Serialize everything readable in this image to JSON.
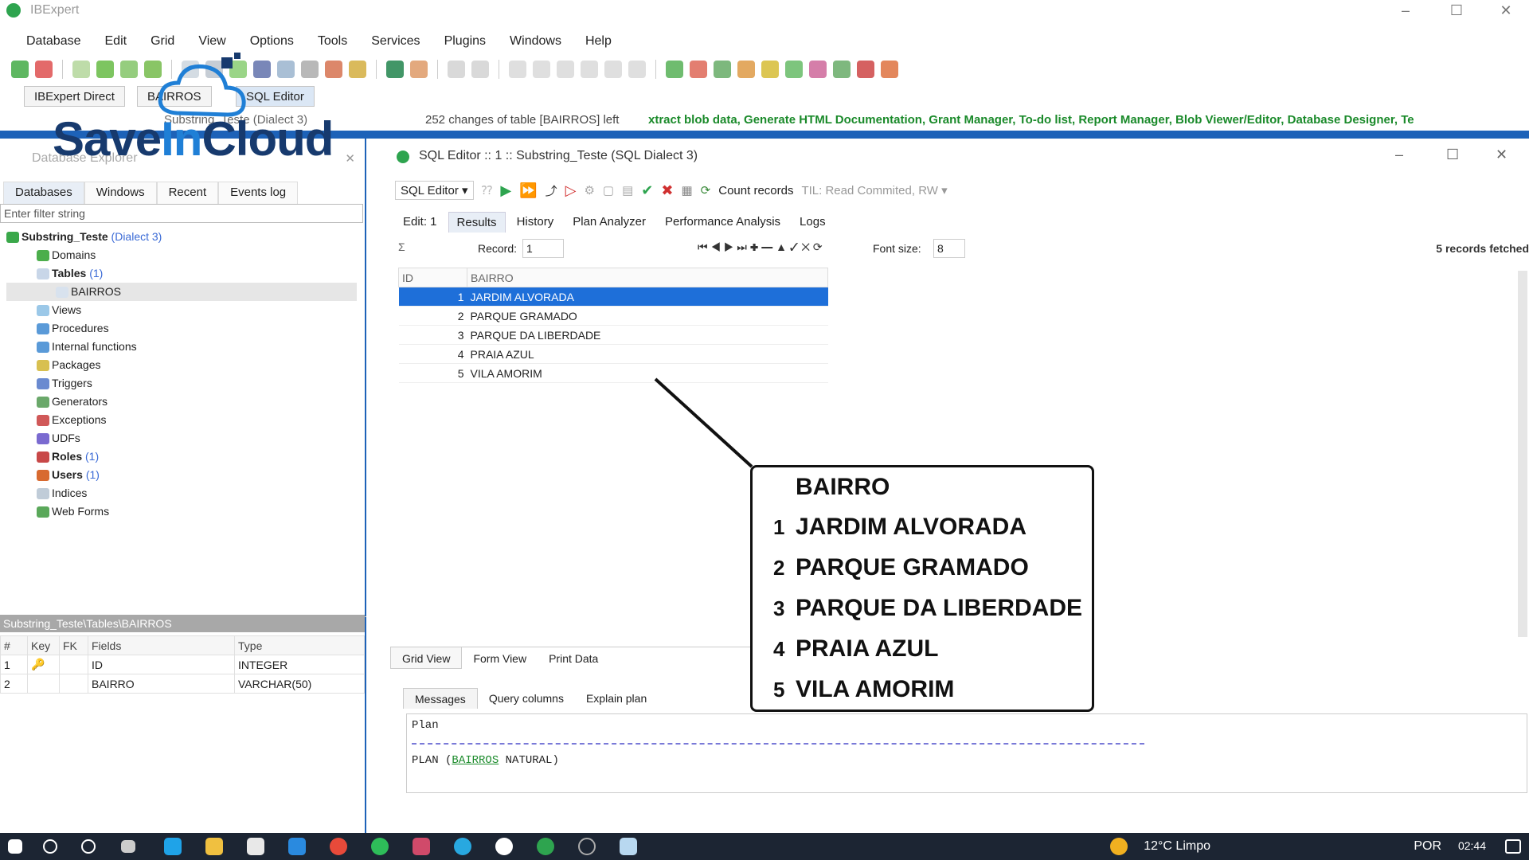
{
  "window": {
    "title": "IBExpert",
    "min": "–",
    "max": "☐",
    "close": "✕"
  },
  "menu": [
    "Database",
    "Edit",
    "Grid",
    "View",
    "Options",
    "Tools",
    "Services",
    "Plugins",
    "Windows",
    "Help"
  ],
  "tabs": {
    "direct": "IBExpert Direct",
    "bairros": "BAIRROS",
    "sql": "SQL Editor"
  },
  "status_strip": {
    "sub": "Substring_Teste (Dialect 3)",
    "changes": "252 changes of table [BAIRROS] left",
    "marquee": "xtract blob data, Generate HTML Documentation, Grant Manager, To-do list, Report Manager, Blob Viewer/Editor, Database Designer, Te"
  },
  "watermark": {
    "part1": "Save",
    "part2": "In",
    "part3": "Cloud"
  },
  "left": {
    "panel_title": "Database Explorer",
    "tabs": [
      "Databases",
      "Windows",
      "Recent",
      "Events log"
    ],
    "filter_placeholder": "Enter filter string",
    "tree": {
      "db": "Substring_Teste",
      "db_dialect": "(Dialect 3)",
      "domains": "Domains",
      "tables": "Tables",
      "tables_count": "(1)",
      "bairros": "BAIRROS",
      "views": "Views",
      "procedures": "Procedures",
      "internal_functions": "Internal functions",
      "packages": "Packages",
      "triggers": "Triggers",
      "generators": "Generators",
      "exceptions": "Exceptions",
      "udfs": "UDFs",
      "roles": "Roles",
      "roles_count": "(1)",
      "users": "Users",
      "users_count": "(1)",
      "indices": "Indices",
      "web_forms": "Web Forms"
    },
    "field_path": "Substring_Teste\\Tables\\BAIRROS",
    "field_headers": [
      "#",
      "Key",
      "FK",
      "Fields",
      "Type"
    ],
    "fields": [
      {
        "n": "1",
        "key": "🔑",
        "fk": "",
        "name": "ID",
        "type": "INTEGER"
      },
      {
        "n": "2",
        "key": "",
        "fk": "",
        "name": "BAIRRO",
        "type": "VARCHAR(50)"
      }
    ]
  },
  "sql": {
    "caption": "SQL Editor :: 1 :: Substring_Teste (SQL Dialect 3)",
    "editor_button": "SQL Editor ▾",
    "count_records": "Count records",
    "til": "TIL: Read Commited, RW ▾",
    "subtabs": [
      "Edit: 1",
      "Results",
      "History",
      "Plan Analyzer",
      "Performance Analysis",
      "Logs"
    ],
    "record_label": "Record:",
    "record_value": "1",
    "font_label": "Font size:",
    "font_value": "8",
    "fetched": "5 records fetched",
    "columns": [
      "ID",
      "BAIRRO"
    ],
    "rows": [
      {
        "id": "1",
        "bairro": "JARDIM ALVORADA"
      },
      {
        "id": "2",
        "bairro": "PARQUE GRAMADO"
      },
      {
        "id": "3",
        "bairro": "PARQUE DA LIBERDADE"
      },
      {
        "id": "4",
        "bairro": "PRAIA AZUL"
      },
      {
        "id": "5",
        "bairro": "VILA AMORIM"
      }
    ],
    "grid_tabs": [
      "Grid View",
      "Form View",
      "Print Data"
    ],
    "msg_tabs": [
      "Messages",
      "Query columns",
      "Explain plan"
    ],
    "msg_plan_title": "Plan",
    "msg_plan_prefix": "PLAN (",
    "msg_plan_table": "BAIRROS",
    "msg_plan_suffix": " NATURAL)"
  },
  "callout": {
    "header": "BAIRRO",
    "rows": [
      {
        "n": "1",
        "t": "JARDIM ALVORADA"
      },
      {
        "n": "2",
        "t": "PARQUE GRAMADO"
      },
      {
        "n": "3",
        "t": "PARQUE DA LIBERDADE"
      },
      {
        "n": "4",
        "t": "PRAIA AZUL"
      },
      {
        "n": "5",
        "t": "VILA AMORIM"
      }
    ]
  },
  "taskbar": {
    "weather": "12°C  Limpo",
    "lang": "POR",
    "time": "02:44"
  },
  "colors": {
    "accent": "#1d62b8",
    "selection": "#1e6fd9",
    "green": "#1a8a2a"
  }
}
